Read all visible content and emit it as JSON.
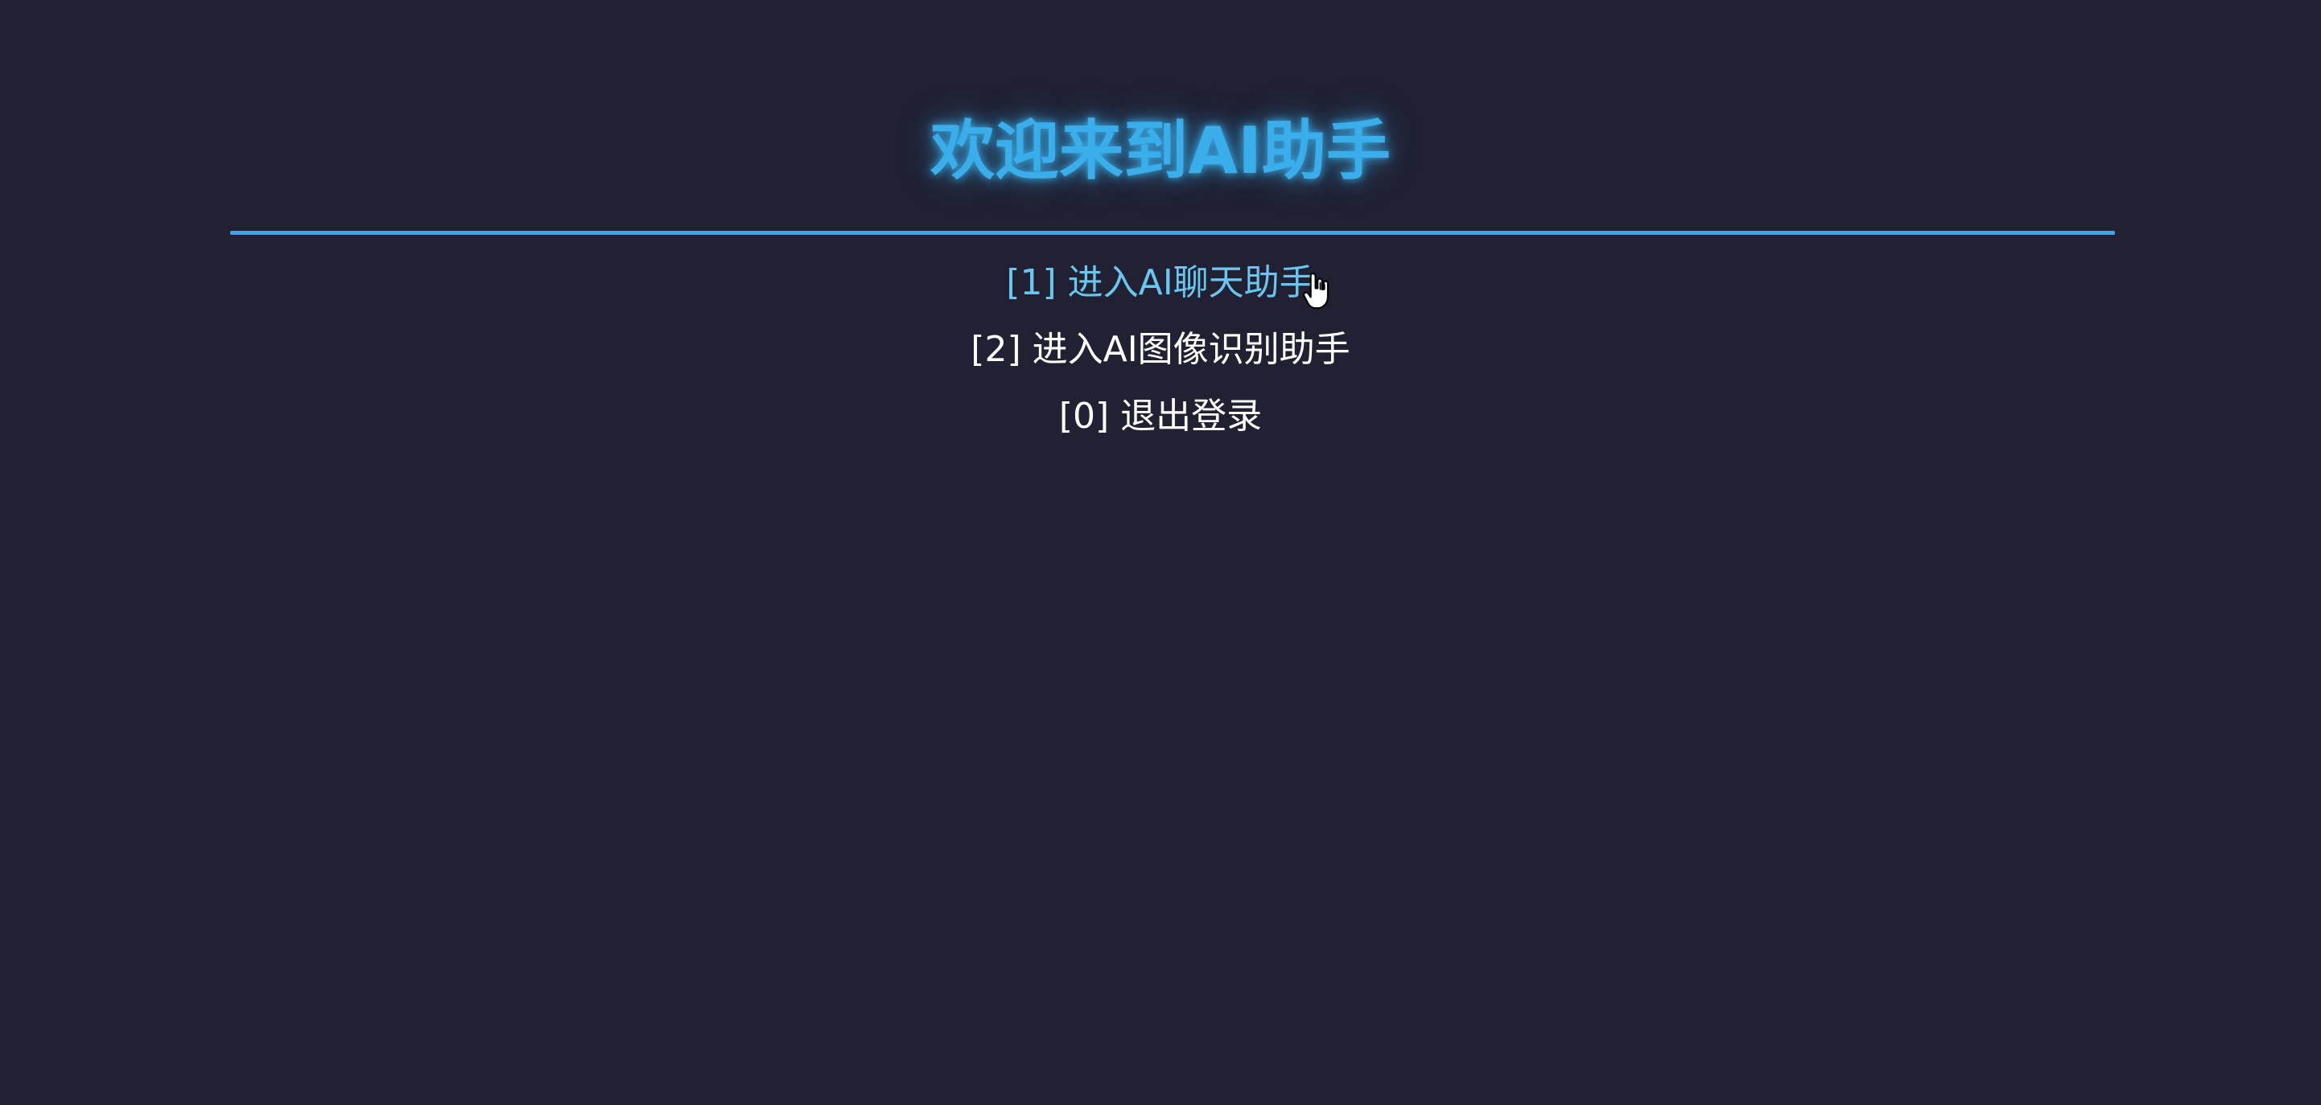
{
  "header": {
    "title": "欢迎来到AI助手"
  },
  "menu": {
    "items": [
      {
        "label": "[1] 进入AI聊天助手",
        "state": "hover"
      },
      {
        "label": "[2] 进入AI图像识别助手",
        "state": "normal"
      },
      {
        "label": "[0] 退出登录",
        "state": "normal"
      }
    ]
  },
  "colors": {
    "background": "#212133",
    "accent": "#3aaeea",
    "hover_text": "#69c7ef",
    "text": "#ffffff"
  },
  "icons": {
    "cursor": "hand-pointer-icon"
  }
}
